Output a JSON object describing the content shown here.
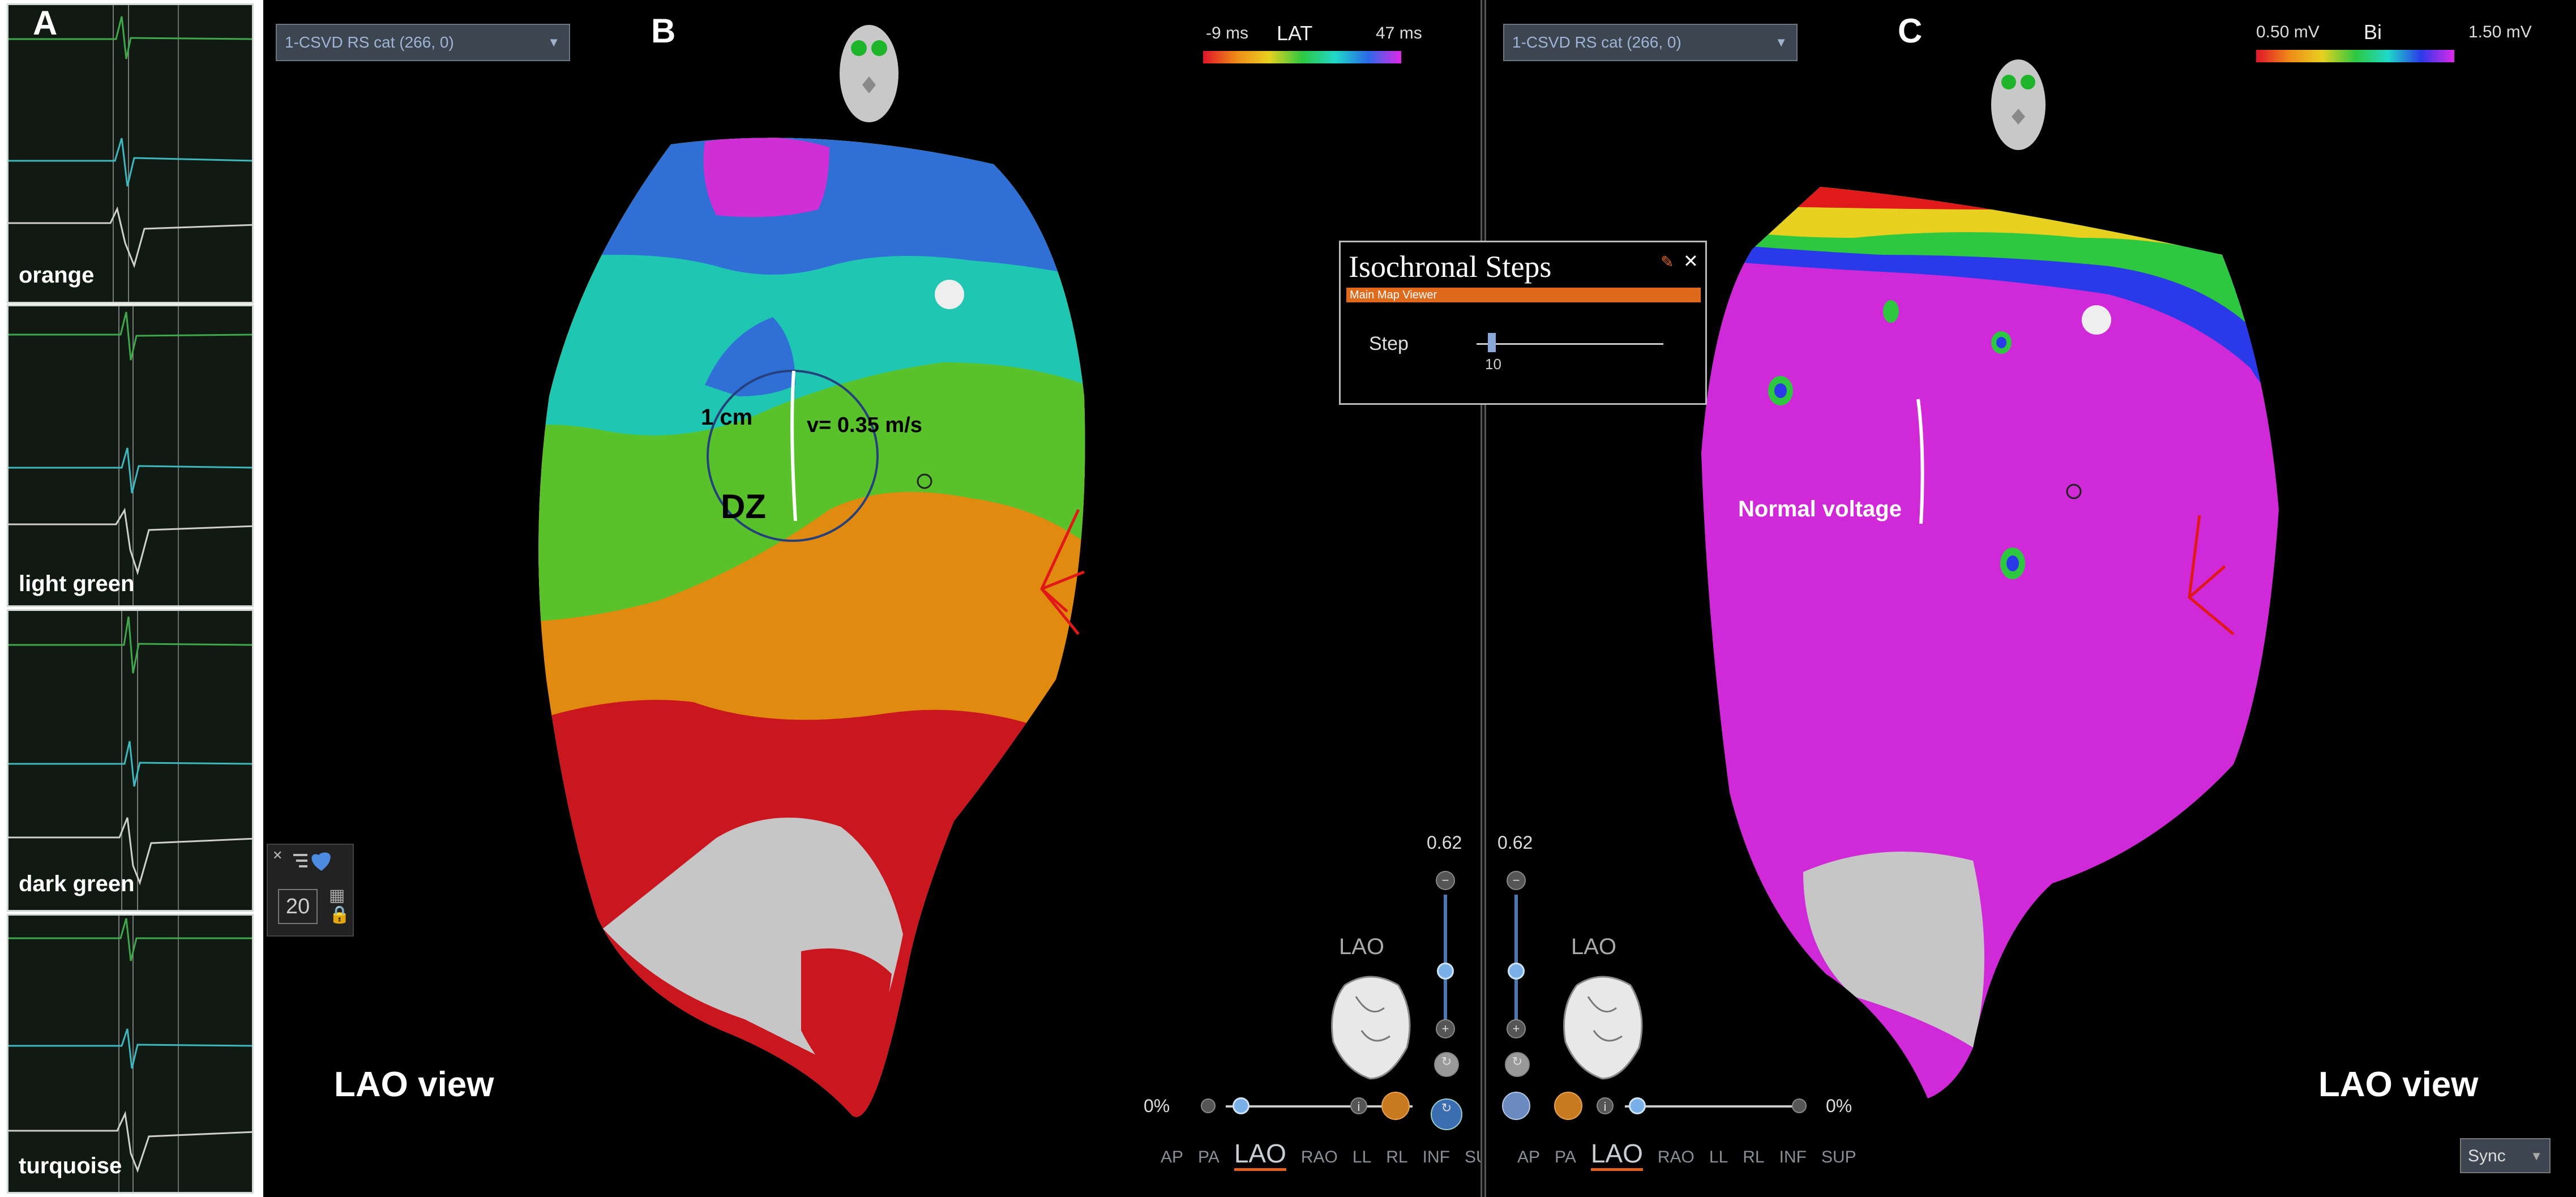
{
  "panel_a": {
    "letter": "A",
    "traces": [
      {
        "label": "orange"
      },
      {
        "label": "light green"
      },
      {
        "label": "dark green"
      },
      {
        "label": "turquoise"
      }
    ]
  },
  "panel_b": {
    "letter": "B",
    "dropdown": "1-CSVD RS cat (266, 0)",
    "scale": {
      "min": "-9 ms",
      "title": "LAT",
      "max": "47 ms"
    },
    "annotations": {
      "distance": "1 cm",
      "velocity": "v= 0.35 m/s",
      "zone": "DZ"
    },
    "view_label": "LAO view",
    "opacity_value": "0.62",
    "percent": "0%",
    "orientation": "LAO",
    "step_box": "20"
  },
  "panel_c": {
    "letter": "C",
    "dropdown": "1-CSVD RS cat (266, 0)",
    "scale": {
      "min": "0.50 mV",
      "title": "Bi",
      "max": "1.50 mV"
    },
    "annotation": "Normal voltage",
    "view_label": "LAO view",
    "opacity_value": "0.62",
    "percent": "0%",
    "orientation": "LAO",
    "sync": "Sync"
  },
  "nav_views": [
    "AP",
    "PA",
    "LAO",
    "RAO",
    "LL",
    "RL",
    "INF",
    "SUP"
  ],
  "isochronal": {
    "title": "Isochronal Steps",
    "subtitle": "Main Map Viewer",
    "step_label": "Step",
    "step_value": "10"
  },
  "colors": {
    "lat_scale": [
      "#e0142a",
      "#f08a18",
      "#e8d020",
      "#2ec840",
      "#20d8c8",
      "#2a6ae8",
      "#e028e8"
    ],
    "voltage_scale": [
      "#e0142a",
      "#f08a18",
      "#e8d020",
      "#2ec840",
      "#20d8c8",
      "#2a3ae8",
      "#e028e8"
    ],
    "voltage_normal": "#d02ad8",
    "accent": "#e06020"
  }
}
